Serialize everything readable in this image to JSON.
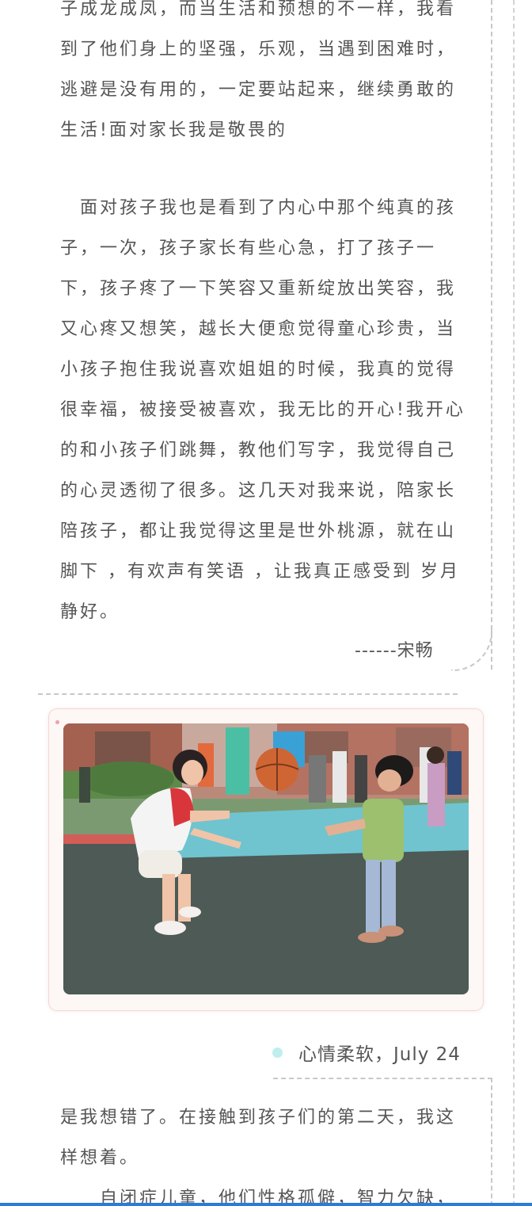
{
  "article": {
    "paragraph1": {
      "lines": [
        "子成龙成凤，而当生活和预想的不一样，我看",
        "到了他们身上的坚强，乐观，当遇到困难时，",
        "逃避是没有用的，一定要站起来，继续勇敢的",
        "生活!面对家长我是敬畏的"
      ]
    },
    "paragraph2": {
      "lines": [
        "　面对孩子我也是看到了内心中那个纯真的孩",
        "子，一次，孩子家长有些心急，打了孩子一",
        "下，孩子疼了一下笑容又重新绽放出笑容，我",
        "又心疼又想笑，越长大便愈觉得童心珍贵，当",
        "小孩子抱住我说喜欢姐姐的时候，我真的觉得",
        "很幸福，被接受被喜欢，我无比的开心!我开心",
        "的和小孩子们跳舞，教他们写字，我觉得自己",
        "的心灵透彻了很多。这几天对我来说，陪家长",
        "陪孩子，都让我觉得这里是世外桃源，就在山",
        "脚下 ，有欢声有笑语 ，让我真正感受到 岁月",
        "静好。"
      ]
    },
    "signature": "------宋畅",
    "section_heading": "心情柔软，July 24",
    "paragraph3": {
      "lines": [
        "是我想错了。在接触到孩子们的第二天，我这",
        "样想着。",
        "　　自闭症儿童，他们性格孤僻，智力欠缺，"
      ]
    }
  },
  "colors": {
    "body_text": "#555555",
    "dashed_border": "#c8c8c8",
    "section_dot": "#bfeeee",
    "bottom_bar": "#2b7bd8"
  }
}
